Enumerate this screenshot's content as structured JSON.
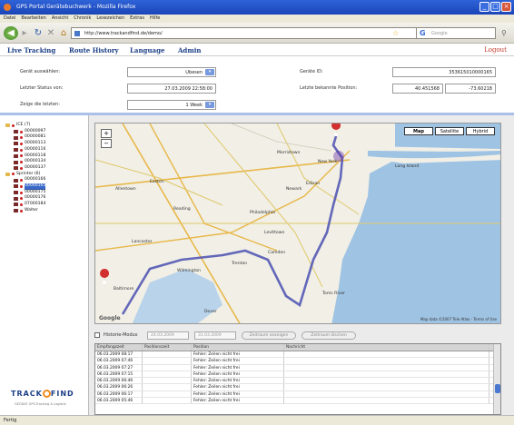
{
  "window": {
    "title": "GPS Portal Gerätebuchwerk - Mozilla Firefox"
  },
  "menu": [
    "Datei",
    "Bearbeiten",
    "Ansicht",
    "Chronik",
    "Lesezeichen",
    "Extras",
    "Hilfe"
  ],
  "browser": {
    "url": "http://www.trackandfind.de/demo/",
    "search_placeholder": "Google"
  },
  "appnav": {
    "items": [
      "Live Tracking",
      "Route History",
      "Language",
      "Admin"
    ],
    "logout": "Logout"
  },
  "form": {
    "device_label": "Gerät auswählen:",
    "device_value": "Ubesen",
    "last_status_label": "Letzter Status von:",
    "last_status_value": "27.03.2009 22:58:00",
    "show_last_label": "Zeige die letzten:",
    "show_last_value": "1 Week",
    "device_id_label": "Geräte ID:",
    "device_id_value": "353615010000165",
    "last_pos_label": "Letzte bekannte Position:",
    "last_pos_lat": "40.451568",
    "last_pos_lon": "-73.60218"
  },
  "tree": [
    {
      "label": "ICE (7)",
      "level": 0,
      "kind": "folder"
    },
    {
      "label": "00000097",
      "level": 1
    },
    {
      "label": "00000081",
      "level": 1
    },
    {
      "label": "00000113",
      "level": 1
    },
    {
      "label": "00000116",
      "level": 1
    },
    {
      "label": "00000118",
      "level": 1
    },
    {
      "label": "00000134",
      "level": 1
    },
    {
      "label": "00000137",
      "level": 1
    },
    {
      "label": "Sprinter (6)",
      "level": 0,
      "kind": "folder"
    },
    {
      "label": "00000166",
      "level": 1
    },
    {
      "label": "00000165",
      "level": 1,
      "selected": true
    },
    {
      "label": "00000175",
      "level": 1
    },
    {
      "label": "00000176",
      "level": 1
    },
    {
      "label": "07000184",
      "level": 1
    },
    {
      "label": "Walter",
      "level": 1
    }
  ],
  "logo": {
    "text": "TRACK",
    "text2": "FIND",
    "sub": "GEODAT GPS-Tracking & Logistik"
  },
  "map": {
    "buttons": [
      "Map",
      "Satellite",
      "Hybrid"
    ],
    "copyright": "Map data ©2007 Tele Atlas - Terms of Use",
    "google": "Google",
    "labels": [
      "Allentown",
      "Easton",
      "Reading",
      "Lancaster",
      "Philadelphia",
      "Trenton",
      "Newark",
      "New York",
      "Long Island",
      "Toms River",
      "Dover",
      "Wilmington",
      "Baltimore",
      "Edison",
      "Camden",
      "Morristown",
      "Levittown"
    ]
  },
  "history": {
    "label": "Historie-Modus",
    "from": "24.03.2009",
    "to": "31.03.2009",
    "btn_show": "Zeitraum anzeigen",
    "btn_clear": "Zeitraum löschen"
  },
  "table": {
    "headers": [
      "Empfangszeit",
      "Positionszeit",
      "Position",
      "Nachricht"
    ],
    "rows": [
      [
        "06.03.2009 08:17",
        "",
        "Fehler: Zeilen nicht frei",
        ""
      ],
      [
        "06.03.2009 07:46",
        "",
        "Fehler: Zeilen nicht frei",
        ""
      ],
      [
        "06.03.2009 07:27",
        "",
        "Fehler: Zeilen nicht frei",
        ""
      ],
      [
        "06.03.2009 07:15",
        "",
        "Fehler: Zeilen nicht frei",
        ""
      ],
      [
        "06.03.2009 06:46",
        "",
        "Fehler: Zeilen nicht frei",
        ""
      ],
      [
        "06.03.2009 06:26",
        "",
        "Fehler: Zeilen nicht frei",
        ""
      ],
      [
        "06.03.2009 06:17",
        "",
        "Fehler: Zeilen nicht frei",
        ""
      ],
      [
        "06.03.2009 05:46",
        "",
        "Fehler: Zeilen nicht frei",
        ""
      ]
    ]
  },
  "status": "Fertig",
  "colors": {
    "accent": "#1c3f86",
    "logout": "#c0392b",
    "route": "#4a4fb0",
    "pin": "#d22f2f"
  }
}
